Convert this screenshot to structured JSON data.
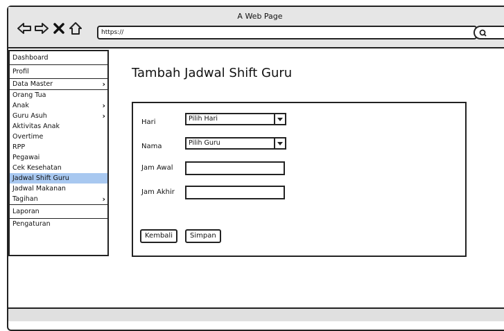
{
  "browser": {
    "title": "A Web Page",
    "url": "https://",
    "icons": [
      "back-arrow-icon",
      "forward-arrow-icon",
      "close-icon",
      "home-icon",
      "search-icon"
    ]
  },
  "sidebar": {
    "items": [
      {
        "label": "Dashboard"
      },
      {
        "label": "Profil"
      },
      {
        "label": "Data Master"
      },
      {
        "label": "Orang Tua"
      },
      {
        "label": "Anak"
      },
      {
        "label": "Guru Asuh"
      },
      {
        "label": "Aktivitas Anak"
      },
      {
        "label": "Overtime"
      },
      {
        "label": "RPP"
      },
      {
        "label": "Pegawai"
      },
      {
        "label": "Cek Kesehatan"
      },
      {
        "label": "Jadwal Shift Guru"
      },
      {
        "label": "Jadwal Makanan"
      },
      {
        "label": "Tagihan"
      },
      {
        "label": "Laporan"
      },
      {
        "label": "Pengaturan"
      }
    ]
  },
  "main": {
    "title": "Tambah Jadwal Shift Guru",
    "form": {
      "hari_label": "Hari",
      "hari_value": "Pilih Hari",
      "nama_label": "Nama",
      "nama_value": "Pilih Guru",
      "jam_awal_label": "Jam Awal",
      "jam_akhir_label": "Jam Akhir",
      "kembali_label": "Kembali",
      "simpan_label": "Simpan"
    }
  },
  "colors": {
    "active_item": "#a8c8f0",
    "chrome": "#e6e6e6"
  }
}
